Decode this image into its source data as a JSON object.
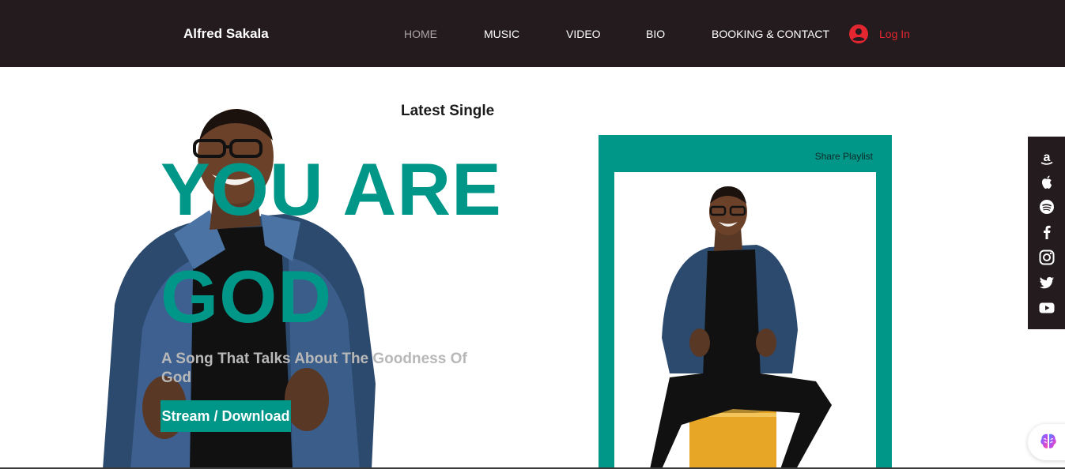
{
  "header": {
    "brand": "Alfred Sakala",
    "nav": [
      {
        "label": "HOME",
        "active": true
      },
      {
        "label": "MUSIC",
        "active": false
      },
      {
        "label": "VIDEO",
        "active": false
      },
      {
        "label": "BIO",
        "active": false
      },
      {
        "label": "BOOKING & CONTACT",
        "active": false
      }
    ],
    "login_label": "Log In"
  },
  "hero": {
    "kicker": "Latest Single",
    "title_line1": "YOU ARE",
    "title_line2": "GOD",
    "description": "A Song That Talks About The Goodness Of God",
    "cta_label": "Stream / Download"
  },
  "playlist": {
    "share_label": "Share Playlist"
  },
  "social": {
    "icons": [
      "amazon-icon",
      "apple-icon",
      "spotify-icon",
      "facebook-icon",
      "instagram-icon",
      "twitter-icon",
      "youtube-icon"
    ]
  },
  "colors": {
    "header_bg": "#241b1f",
    "accent_teal": "#009688",
    "login_red": "#e3262f",
    "nav_active": "#a9a4a6",
    "description_gray": "#b8b8b8"
  }
}
